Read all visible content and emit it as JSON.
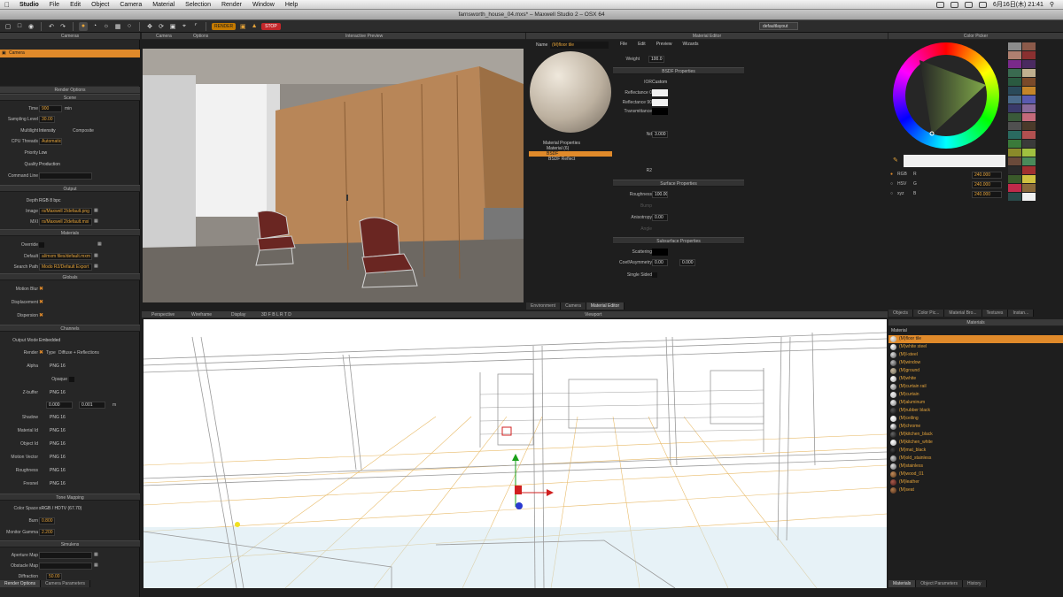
{
  "menubar": {
    "app": "Studio",
    "items": [
      "File",
      "Edit",
      "Object",
      "Camera",
      "Material",
      "Selection",
      "Render",
      "Window",
      "Help"
    ],
    "clock": "6月16日(木)  21:41"
  },
  "window_title": "farnsworth_house_04.mxs* – Maxwell Studio 2 – OSX 64",
  "toolbar": {
    "render_label": "RENDER",
    "stop_label": "STOP",
    "layout": "defaultlayout"
  },
  "camera_panel": {
    "title": "Cameras",
    "item": "Camera"
  },
  "render_options": {
    "title": "Render Options",
    "scene_header": "Scene",
    "time_label": "Time",
    "time": "900",
    "time_unit": "min",
    "sl_label": "Sampling Level",
    "sl": "30.00",
    "multilight_label": "Multilight",
    "multilight": "Intensity",
    "composite": "Composite",
    "cpu_label": "CPU Threads",
    "cpu": "Automatic",
    "priority_label": "Priority",
    "priority": "Low",
    "quality_label": "Quality",
    "quality": "Production",
    "cmd_label": "Command Line",
    "output_header": "Output",
    "depth_label": "Depth",
    "depth": "RGB  8 bpc",
    "image_label": "Image",
    "image": "rs/Maxwell 2/default.png",
    "mxi_label": "MXI",
    "mxi": "rs/Maxwell 2/default.mxi",
    "materials_header": "Materials",
    "override_label": "Override",
    "default_label": "Default",
    "default": "al/mxm files/default.mxm",
    "search_label": "Search Path",
    "search": "Modo R2/Default Export",
    "globals_header": "Globals",
    "motionblur_label": "Motion Blur",
    "displacement_label": "Displacement",
    "dispersion_label": "Dispersion",
    "channels_header": "Channels",
    "outmode_label": "Output Mode",
    "outmode": "Embedded",
    "render_label": "Render",
    "render_type_label": "Type",
    "render_type": "Diffuse + Reflections",
    "alpha_label": "Alpha",
    "opaque_label": "Opaque",
    "zbuffer_label": "Z-buffer",
    "z_min": "0.000",
    "z_max": "0.001",
    "z_unit": "m",
    "shadow_label": "Shadow",
    "materialid_label": "Material Id",
    "objectid_label": "Object Id",
    "motionvec_label": "Motion Vector",
    "roughness_label": "Roughness",
    "fresnel_label": "Fresnel",
    "png16": "PNG 16",
    "tone_header": "Tone Mapping",
    "colorspace_label": "Color Space",
    "colorspace": "sRGB / HDTV (67.70)",
    "burn_label": "Burn",
    "burn": "0.800",
    "gamma_label": "Monitor Gamma",
    "gamma": "2.200",
    "simulens_header": "Simulens",
    "aperture_label": "Aperture Map",
    "obstacle_label": "Obstacle Map",
    "diffraction_label": "Diffraction",
    "diffraction": "50.00",
    "bottom_tabs": [
      "Render Options",
      "Camera Parameters"
    ]
  },
  "preview": {
    "title": "Interactive Preview",
    "menus": [
      "Camera",
      "Options"
    ]
  },
  "material_editor": {
    "title": "Material Editor",
    "name_label": "Name",
    "name": "(M)floor tile",
    "menus": [
      "File",
      "Edit",
      "Preview",
      "Wizards"
    ],
    "weight_label": "Weight",
    "weight": "100.0",
    "bsdf_header": "BSDF Properties",
    "ior_label": "IOR",
    "ior": "Custom",
    "refl0_label": "Reflectance 0",
    "refl90_label": "Reflectance 90",
    "trans_label": "Transmittance",
    "nd_label": "Nd",
    "nd": "3.000",
    "r2_label": "R2",
    "surface_header": "Surface Properties",
    "rough_label": "Roughness",
    "rough": "100.00",
    "bump_label": "Bump",
    "aniso_label": "Anisotropy",
    "aniso": "0.00",
    "angle_label": "Angle",
    "sss_header": "Subsurface Properties",
    "scatter_label": "Scattering",
    "coef_label": "Coef/Asymmetry",
    "coef": "0.00",
    "asym": "0.000",
    "single_label": "Single Sided",
    "tree": [
      "Material Properties",
      "Material (6)",
      "BSDF",
      "BSDF Reflect"
    ],
    "bottom_tabs": [
      "Environment",
      "Camera",
      "Material Editor"
    ]
  },
  "color_picker": {
    "title": "Color Picker",
    "rgb_label": "RGB",
    "hsv_label": "HSV",
    "xyz_label": "xyz",
    "r_label": "R",
    "g_label": "G",
    "b_label": "B",
    "r": "240.000",
    "g": "240.000",
    "b": "240.000"
  },
  "viewport": {
    "title": "Viewport",
    "menus": [
      "Perspective",
      "Wireframe",
      "Display"
    ],
    "views": "3D  F  B  L  R  T  D"
  },
  "right_tabs": [
    "Objects",
    "Color Pic...",
    "Material Bro...",
    "Textures",
    "Instan..."
  ],
  "materials": {
    "title": "Materials",
    "header": "Material",
    "items": [
      "(M)floor tile",
      "(M)white steel",
      "(M)l-steel",
      "(M)window",
      "(M)ground",
      "(M)white",
      "(M)curtain rail",
      "(M)curtain",
      "(M)aluminum",
      "(M)rubber black",
      "(M)ceiling",
      "(M)chrome",
      "(M)kitchen_black",
      "(M)kitchen_white",
      "(M)mat_black",
      "(M)old_stainless",
      "(M)stainless",
      "(M)wood_01",
      "(M)leather",
      "(M)seat"
    ],
    "bottom_tabs": [
      "Materials",
      "Object Parameters",
      "History"
    ]
  },
  "swatches": [
    "#8c8c8c",
    "#8b5a4a",
    "#b08070",
    "#8a3030",
    "#7a2a8a",
    "#4a2a60",
    "#3a6a50",
    "#c0b090",
    "#2a5a40",
    "#7a4a2a",
    "#2a4a5a",
    "#c4852a",
    "#4a6a8a",
    "#5a5ab0",
    "#3a3a6a",
    "#8a6a9a",
    "#3a5a3a",
    "#c46a7a",
    "#505050",
    "#4a3a2a",
    "#2a6a60",
    "#b05050",
    "#3a7a3a",
    "#3a3a3a",
    "#8a8a2a",
    "#a0c040",
    "#6a4a3a",
    "#4a8a5a",
    "#2a2a2a",
    "#a03030",
    "#3a5a2a",
    "#d0c040",
    "#c02a4a",
    "#8a6a3a",
    "#2a4a4a",
    "#f0f0f0"
  ]
}
